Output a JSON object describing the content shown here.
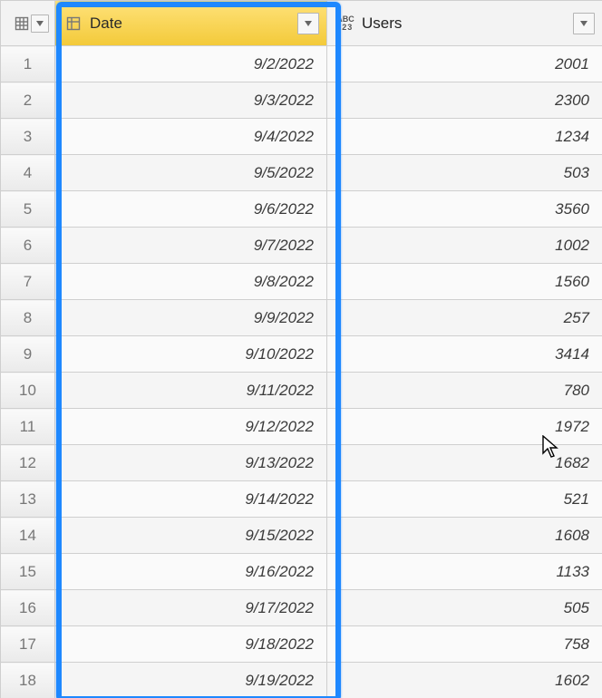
{
  "columns": {
    "date": {
      "label": "Date",
      "type_icon": "table-icon"
    },
    "users": {
      "label": "Users",
      "type_icon": "abc123-icon"
    }
  },
  "row_numbers": [
    "1",
    "2",
    "3",
    "4",
    "5",
    "6",
    "7",
    "8",
    "9",
    "10",
    "11",
    "12",
    "13",
    "14",
    "15",
    "16",
    "17",
    "18"
  ],
  "rows": [
    {
      "date": "9/2/2022",
      "users": "2001"
    },
    {
      "date": "9/3/2022",
      "users": "2300"
    },
    {
      "date": "9/4/2022",
      "users": "1234"
    },
    {
      "date": "9/5/2022",
      "users": "503"
    },
    {
      "date": "9/6/2022",
      "users": "3560"
    },
    {
      "date": "9/7/2022",
      "users": "1002"
    },
    {
      "date": "9/8/2022",
      "users": "1560"
    },
    {
      "date": "9/9/2022",
      "users": "257"
    },
    {
      "date": "9/10/2022",
      "users": "3414"
    },
    {
      "date": "9/11/2022",
      "users": "780"
    },
    {
      "date": "9/12/2022",
      "users": "1972"
    },
    {
      "date": "9/13/2022",
      "users": "1682"
    },
    {
      "date": "9/14/2022",
      "users": "521"
    },
    {
      "date": "9/15/2022",
      "users": "1608"
    },
    {
      "date": "9/16/2022",
      "users": "1133"
    },
    {
      "date": "9/17/2022",
      "users": "505"
    },
    {
      "date": "9/18/2022",
      "users": "758"
    },
    {
      "date": "9/19/2022",
      "users": "1602"
    }
  ],
  "selection_highlight_column": "date"
}
